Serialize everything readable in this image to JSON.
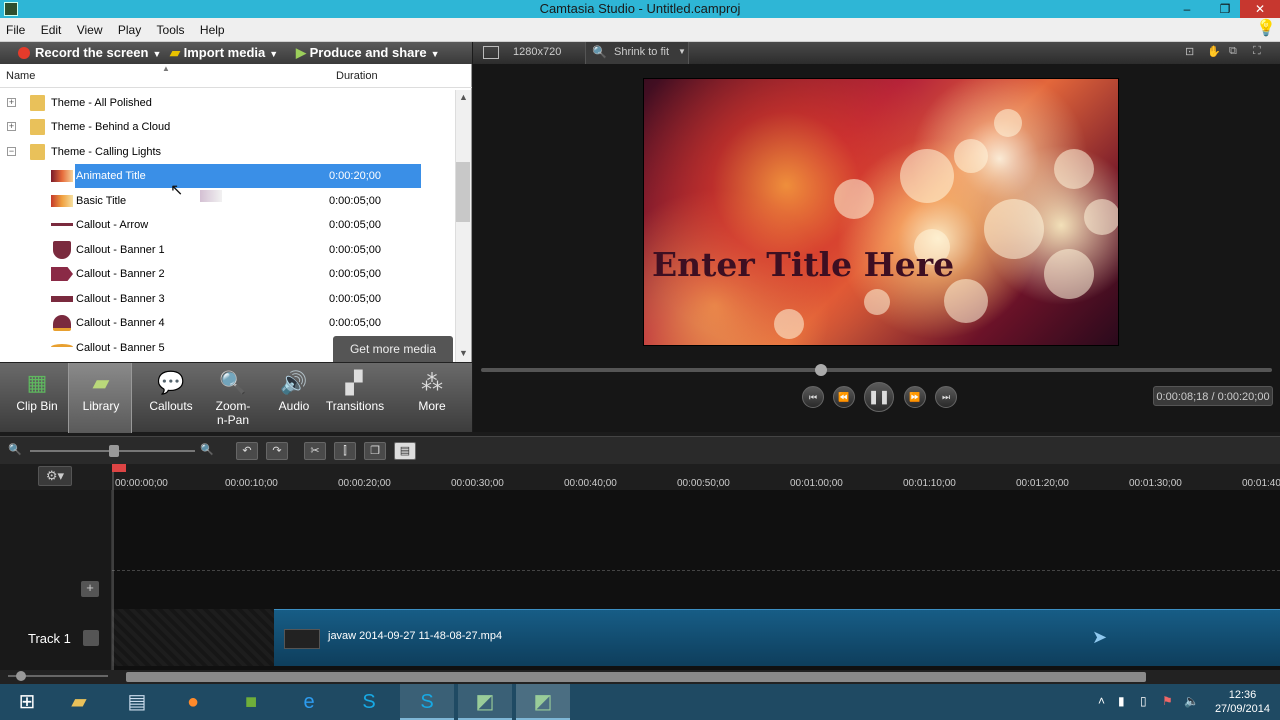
{
  "window": {
    "title": "Camtasia Studio - Untitled.camproj",
    "minimize": "–",
    "restore": "❐",
    "close": "✕"
  },
  "menu": [
    "File",
    "Edit",
    "View",
    "Play",
    "Tools",
    "Help"
  ],
  "toolbar": {
    "record": "Record the screen",
    "import": "Import media",
    "produce": "Produce and share"
  },
  "library": {
    "col_name": "Name",
    "col_duration": "Duration",
    "folders": [
      {
        "label": "Theme - All Polished",
        "expander": "+"
      },
      {
        "label": "Theme - Behind a Cloud",
        "expander": "+"
      },
      {
        "label": "Theme - Calling Lights",
        "expander": "−"
      }
    ],
    "items": [
      {
        "label": "Animated Title",
        "duration": "0:00:20;00"
      },
      {
        "label": "Basic Title",
        "duration": "0:00:05;00"
      },
      {
        "label": "Callout - Arrow",
        "duration": "0:00:05;00"
      },
      {
        "label": "Callout - Banner 1",
        "duration": "0:00:05;00"
      },
      {
        "label": "Callout - Banner 2",
        "duration": "0:00:05;00"
      },
      {
        "label": "Callout - Banner 3",
        "duration": "0:00:05;00"
      },
      {
        "label": "Callout - Banner 4",
        "duration": "0:00:05;00"
      },
      {
        "label": "Callout - Banner 5",
        "duration": ""
      }
    ],
    "get_more": "Get more media"
  },
  "tabs": [
    {
      "label": "Clip Bin",
      "icon": "▦"
    },
    {
      "label": "Library",
      "icon": "▰"
    },
    {
      "label": "Callouts",
      "icon": "💬"
    },
    {
      "label": "Zoom-n-Pan",
      "icon": "🔍"
    },
    {
      "label": "Audio",
      "icon": "🔊"
    },
    {
      "label": "Transitions",
      "icon": "▞"
    },
    {
      "label": "More",
      "icon": "⁂"
    }
  ],
  "preview": {
    "dimensions": "1280x720",
    "zoom": "Shrink to fit",
    "canvas_title": "Enter Title Here",
    "timecode": "0:00:08;18 / 0:00:20;00",
    "progress": 0.43
  },
  "timeline": {
    "ticks": [
      "00:00:00;00",
      "00:00:10;00",
      "00:00:20;00",
      "00:00:30;00",
      "00:00:40;00",
      "00:00:50;00",
      "00:01:00;00",
      "00:01:10;00",
      "00:01:20;00",
      "00:01:30;00",
      "00:01:40"
    ],
    "track1_label": "Track 1",
    "clip_label": "javaw 2014-09-27 11-48-08-27.mp4"
  },
  "taskbar": {
    "time": "12:36",
    "date": "27/09/2014"
  }
}
